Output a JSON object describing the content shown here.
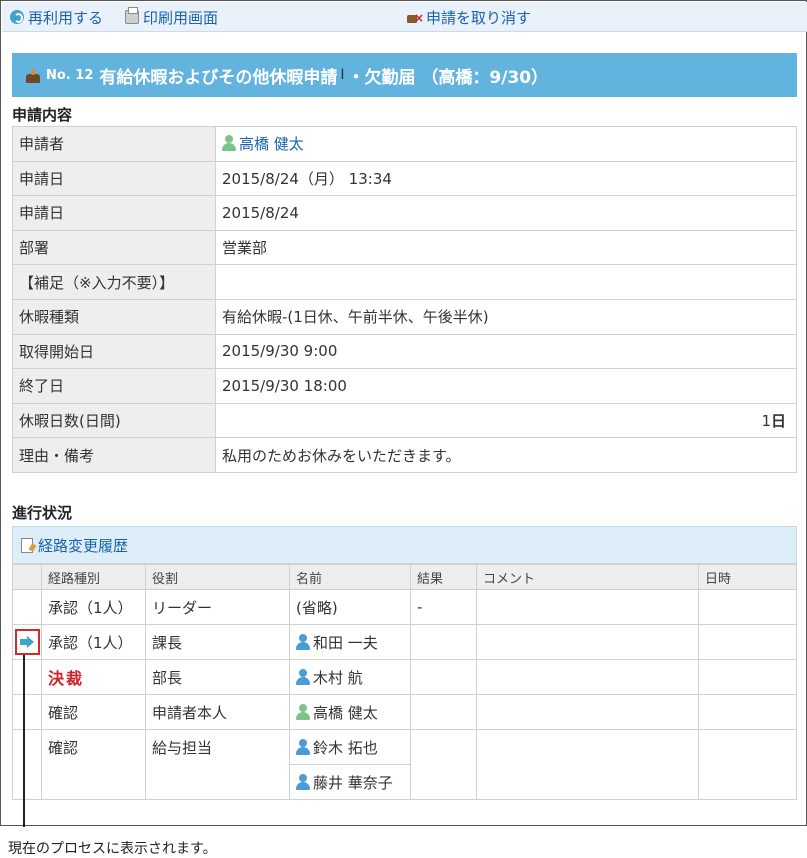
{
  "toolbar": {
    "reuse": "再利用する",
    "print": "印刷用画面",
    "cancel": "申請を取り消す"
  },
  "title": {
    "no": "No. 12",
    "text": "有給休暇およびその他休暇申請",
    "suffix": "・欠勤届 （高橋：9/30）"
  },
  "details": {
    "section_title": "申請内容",
    "rows": [
      {
        "label": "申請者",
        "value": "高橋 健太"
      },
      {
        "label": "申請日",
        "value": "2015/8/24（月） 13:34"
      },
      {
        "label": "申請日",
        "value": "2015/8/24"
      },
      {
        "label": "部署",
        "value": "営業部"
      },
      {
        "label": "【補足（※入力不要）】",
        "value": ""
      },
      {
        "label": "休暇種類",
        "value": "有給休暇-(1日休、午前半休、午後半休)"
      },
      {
        "label": "取得開始日",
        "value": "2015/9/30 9:00"
      },
      {
        "label": "終了日",
        "value": "2015/9/30 18:00"
      },
      {
        "label": "休暇日数(日間)",
        "value_num": "1",
        "value_unit": "日"
      },
      {
        "label": "理由・備考",
        "value": "私用のためお休みをいただきます。"
      }
    ]
  },
  "progress": {
    "section_title": "進行状況",
    "route_history": "経路変更履歴",
    "columns": [
      "経路種別",
      "役割",
      "名前",
      "結果",
      "コメント",
      "日時"
    ],
    "rows": [
      {
        "type": "承認（1人）",
        "role": "リーダー",
        "name": "(省略)",
        "result": "-"
      },
      {
        "type": "承認（1人）",
        "role": "課長",
        "name": "和田 一夫",
        "result": ""
      },
      {
        "type": "決裁",
        "role": "部長",
        "name": "木村 航",
        "result": ""
      },
      {
        "type": "確認",
        "role": "申請者本人",
        "name": "高橋 健太",
        "result": ""
      },
      {
        "type": "確認",
        "role": "給与担当",
        "name": "鈴木 拓也",
        "name2": "藤井 華奈子",
        "result": ""
      }
    ]
  },
  "colors": {
    "title_bar": "#63b3df",
    "link": "#1a62b0",
    "highlight_border": "#d32a2a",
    "user_green": "#7cc48a",
    "user_blue": "#4a9bd6"
  },
  "callout": "現在のプロセスに表示されます。"
}
